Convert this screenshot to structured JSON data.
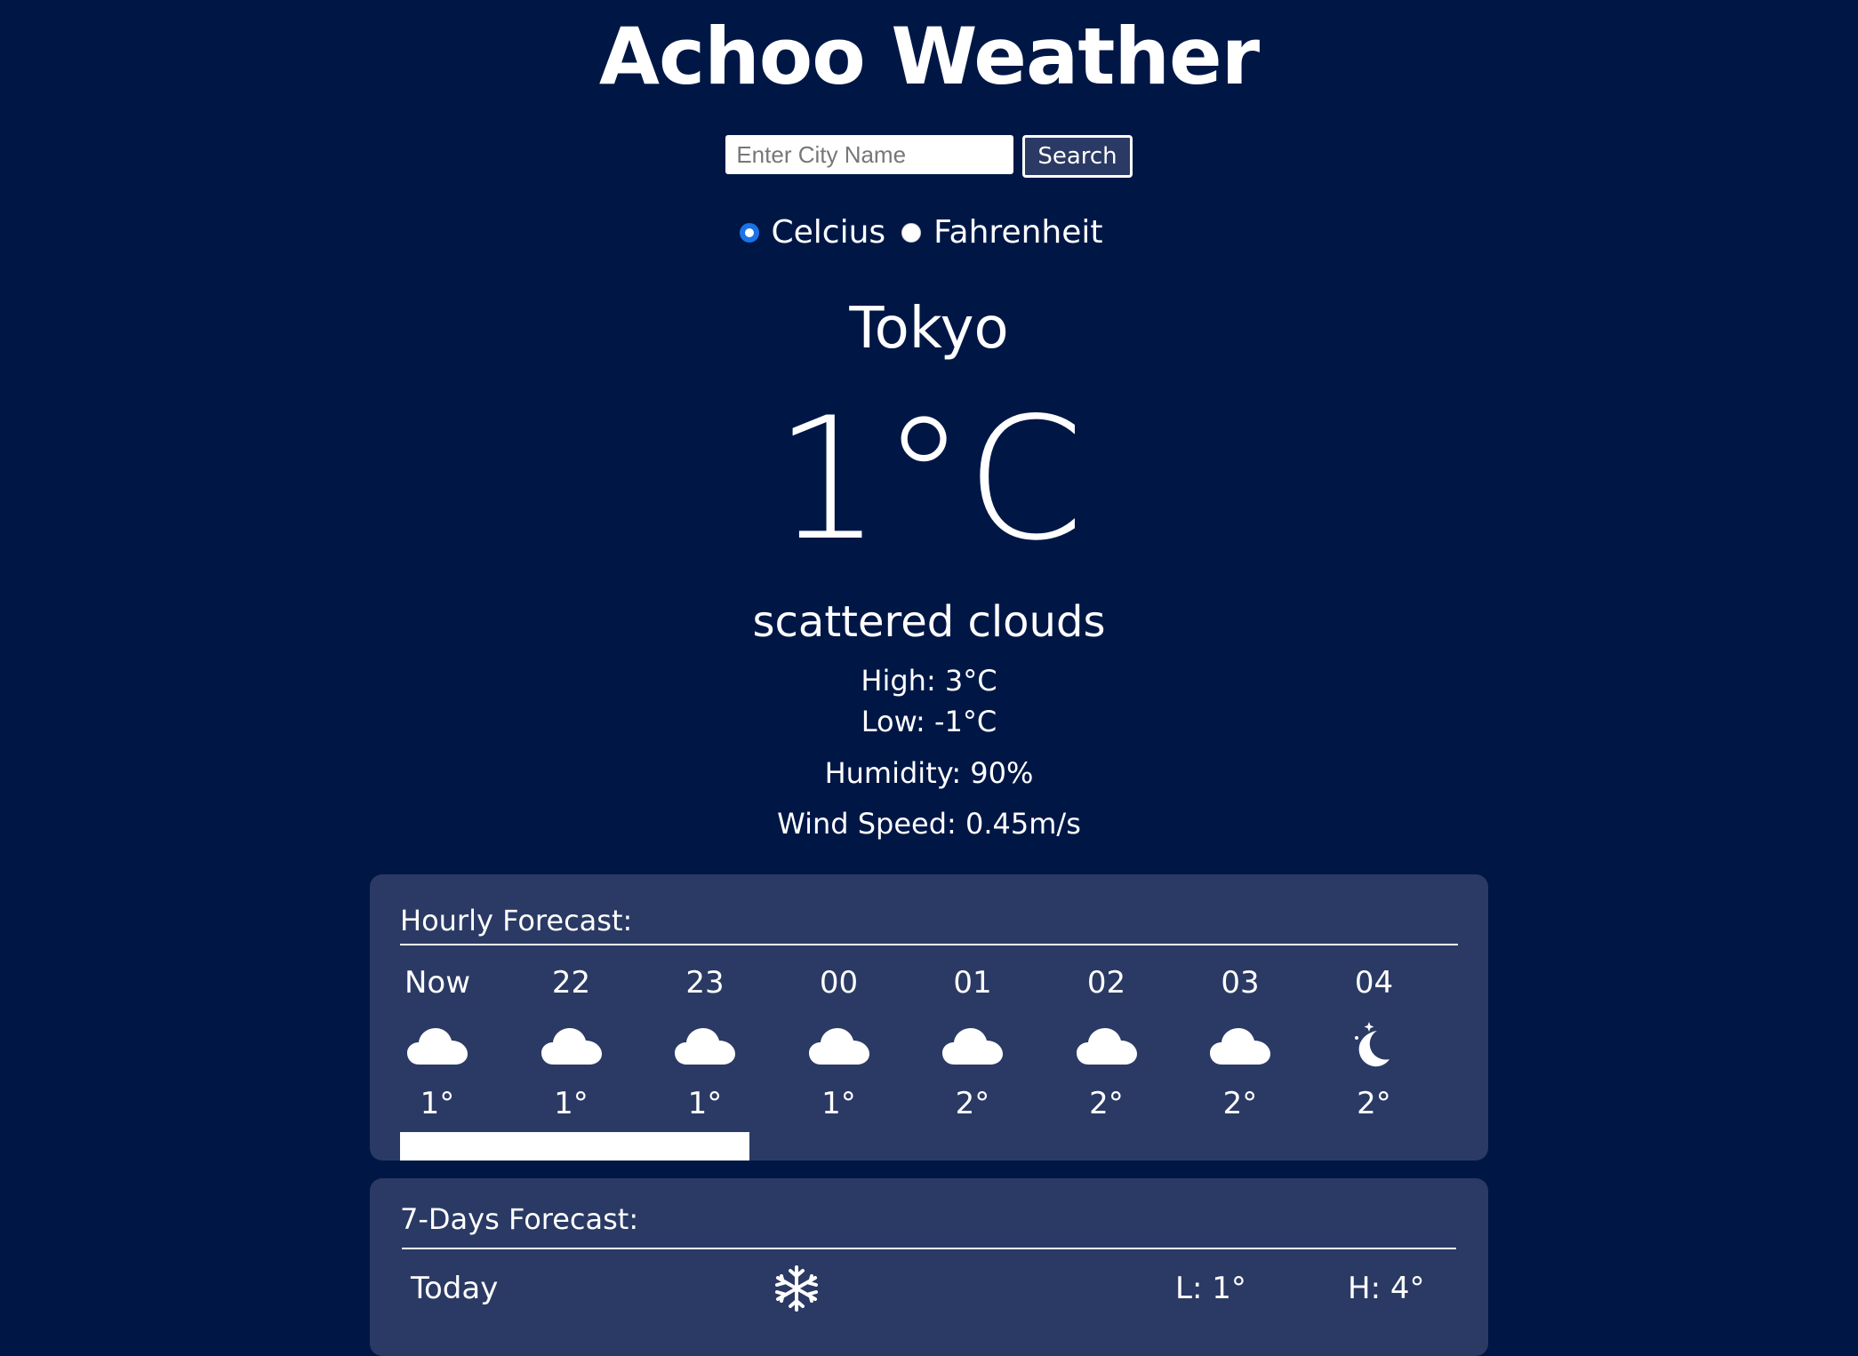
{
  "app": {
    "title": "Achoo Weather"
  },
  "search": {
    "placeholder": "Enter City Name",
    "value": "",
    "button_label": "Search"
  },
  "units": {
    "options": [
      "Celcius",
      "Fahrenheit"
    ],
    "selected": "Celcius"
  },
  "current": {
    "city": "Tokyo",
    "temperature": "1°C",
    "description": "scattered clouds",
    "high": "High: 3°C",
    "low": "Low: -1°C",
    "humidity": "Humidity: 90%",
    "wind": "Wind Speed: 0.45m/s"
  },
  "hourly": {
    "title": "Hourly Forecast:",
    "scroll_visible_fraction": 0.33,
    "items": [
      {
        "label": "Now",
        "icon": "cloud-icon",
        "temp": "1°"
      },
      {
        "label": "22",
        "icon": "cloud-icon",
        "temp": "1°"
      },
      {
        "label": "23",
        "icon": "cloud-icon",
        "temp": "1°"
      },
      {
        "label": "00",
        "icon": "cloud-icon",
        "temp": "1°"
      },
      {
        "label": "01",
        "icon": "cloud-icon",
        "temp": "2°"
      },
      {
        "label": "02",
        "icon": "cloud-icon",
        "temp": "2°"
      },
      {
        "label": "03",
        "icon": "cloud-icon",
        "temp": "2°"
      },
      {
        "label": "04",
        "icon": "moon-icon",
        "temp": "2°"
      }
    ]
  },
  "daily": {
    "title": "7-Days Forecast:",
    "items": [
      {
        "day": "Today",
        "icon": "snowflake-icon",
        "low": "L: 1°",
        "high": "H: 4°"
      }
    ]
  },
  "colors": {
    "background": "#001746",
    "panel": "#2b3a64",
    "text": "#ffffff",
    "radio_accent": "#1a73e8"
  }
}
